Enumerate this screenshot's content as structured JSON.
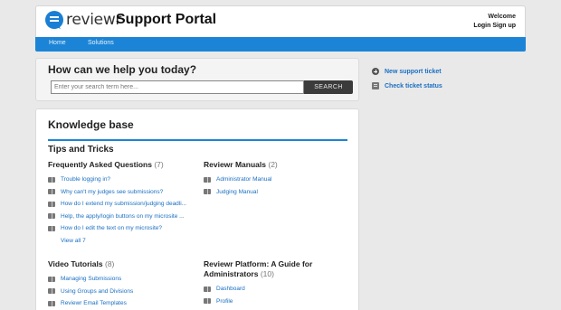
{
  "header": {
    "logo_text": "reviewr",
    "title": "Support Portal",
    "welcome": "Welcome",
    "login": "Login",
    "signup": "Sign up"
  },
  "nav": {
    "items": [
      {
        "label": "Home"
      },
      {
        "label": "Solutions"
      }
    ]
  },
  "search": {
    "title": "How can we help you today?",
    "placeholder": "Enter your search term here...",
    "button": "SEARCH"
  },
  "side_links": [
    {
      "label": "New support ticket",
      "icon": "plus-icon"
    },
    {
      "label": "Check ticket status",
      "icon": "ticket-status-icon"
    }
  ],
  "kb": {
    "title": "Knowledge base",
    "subtitle": "Tips and Tricks",
    "sections": {
      "faq": {
        "title": "Frequently Asked Questions",
        "count": "(7)",
        "articles": [
          "Trouble logging in?",
          "Why can't my judges see submissions?",
          "How do I extend my submission/judging deadli...",
          "Help, the apply/login buttons on my microsite ...",
          "How do I edit the text on my microsite?"
        ],
        "view_all": "View all 7"
      },
      "manuals": {
        "title": "Reviewr Manuals",
        "count": "(2)",
        "articles": [
          "Administrator Manual",
          "Judging Manual"
        ]
      },
      "videos": {
        "title": "Video Tutorials",
        "count": "(8)",
        "articles": [
          "Managing Submissions",
          "Using Groups and Divisions",
          "Reviewr Email Templates"
        ]
      },
      "platform": {
        "title_line1": "Reviewr Platform: A Guide for",
        "title_line2": "Administrators",
        "count": "(10)",
        "articles": [
          "Dashboard",
          "Profile"
        ]
      }
    }
  },
  "colors": {
    "accent": "#1b84d6",
    "link": "#1a6fc2",
    "search_button": "#3b3b3b"
  }
}
